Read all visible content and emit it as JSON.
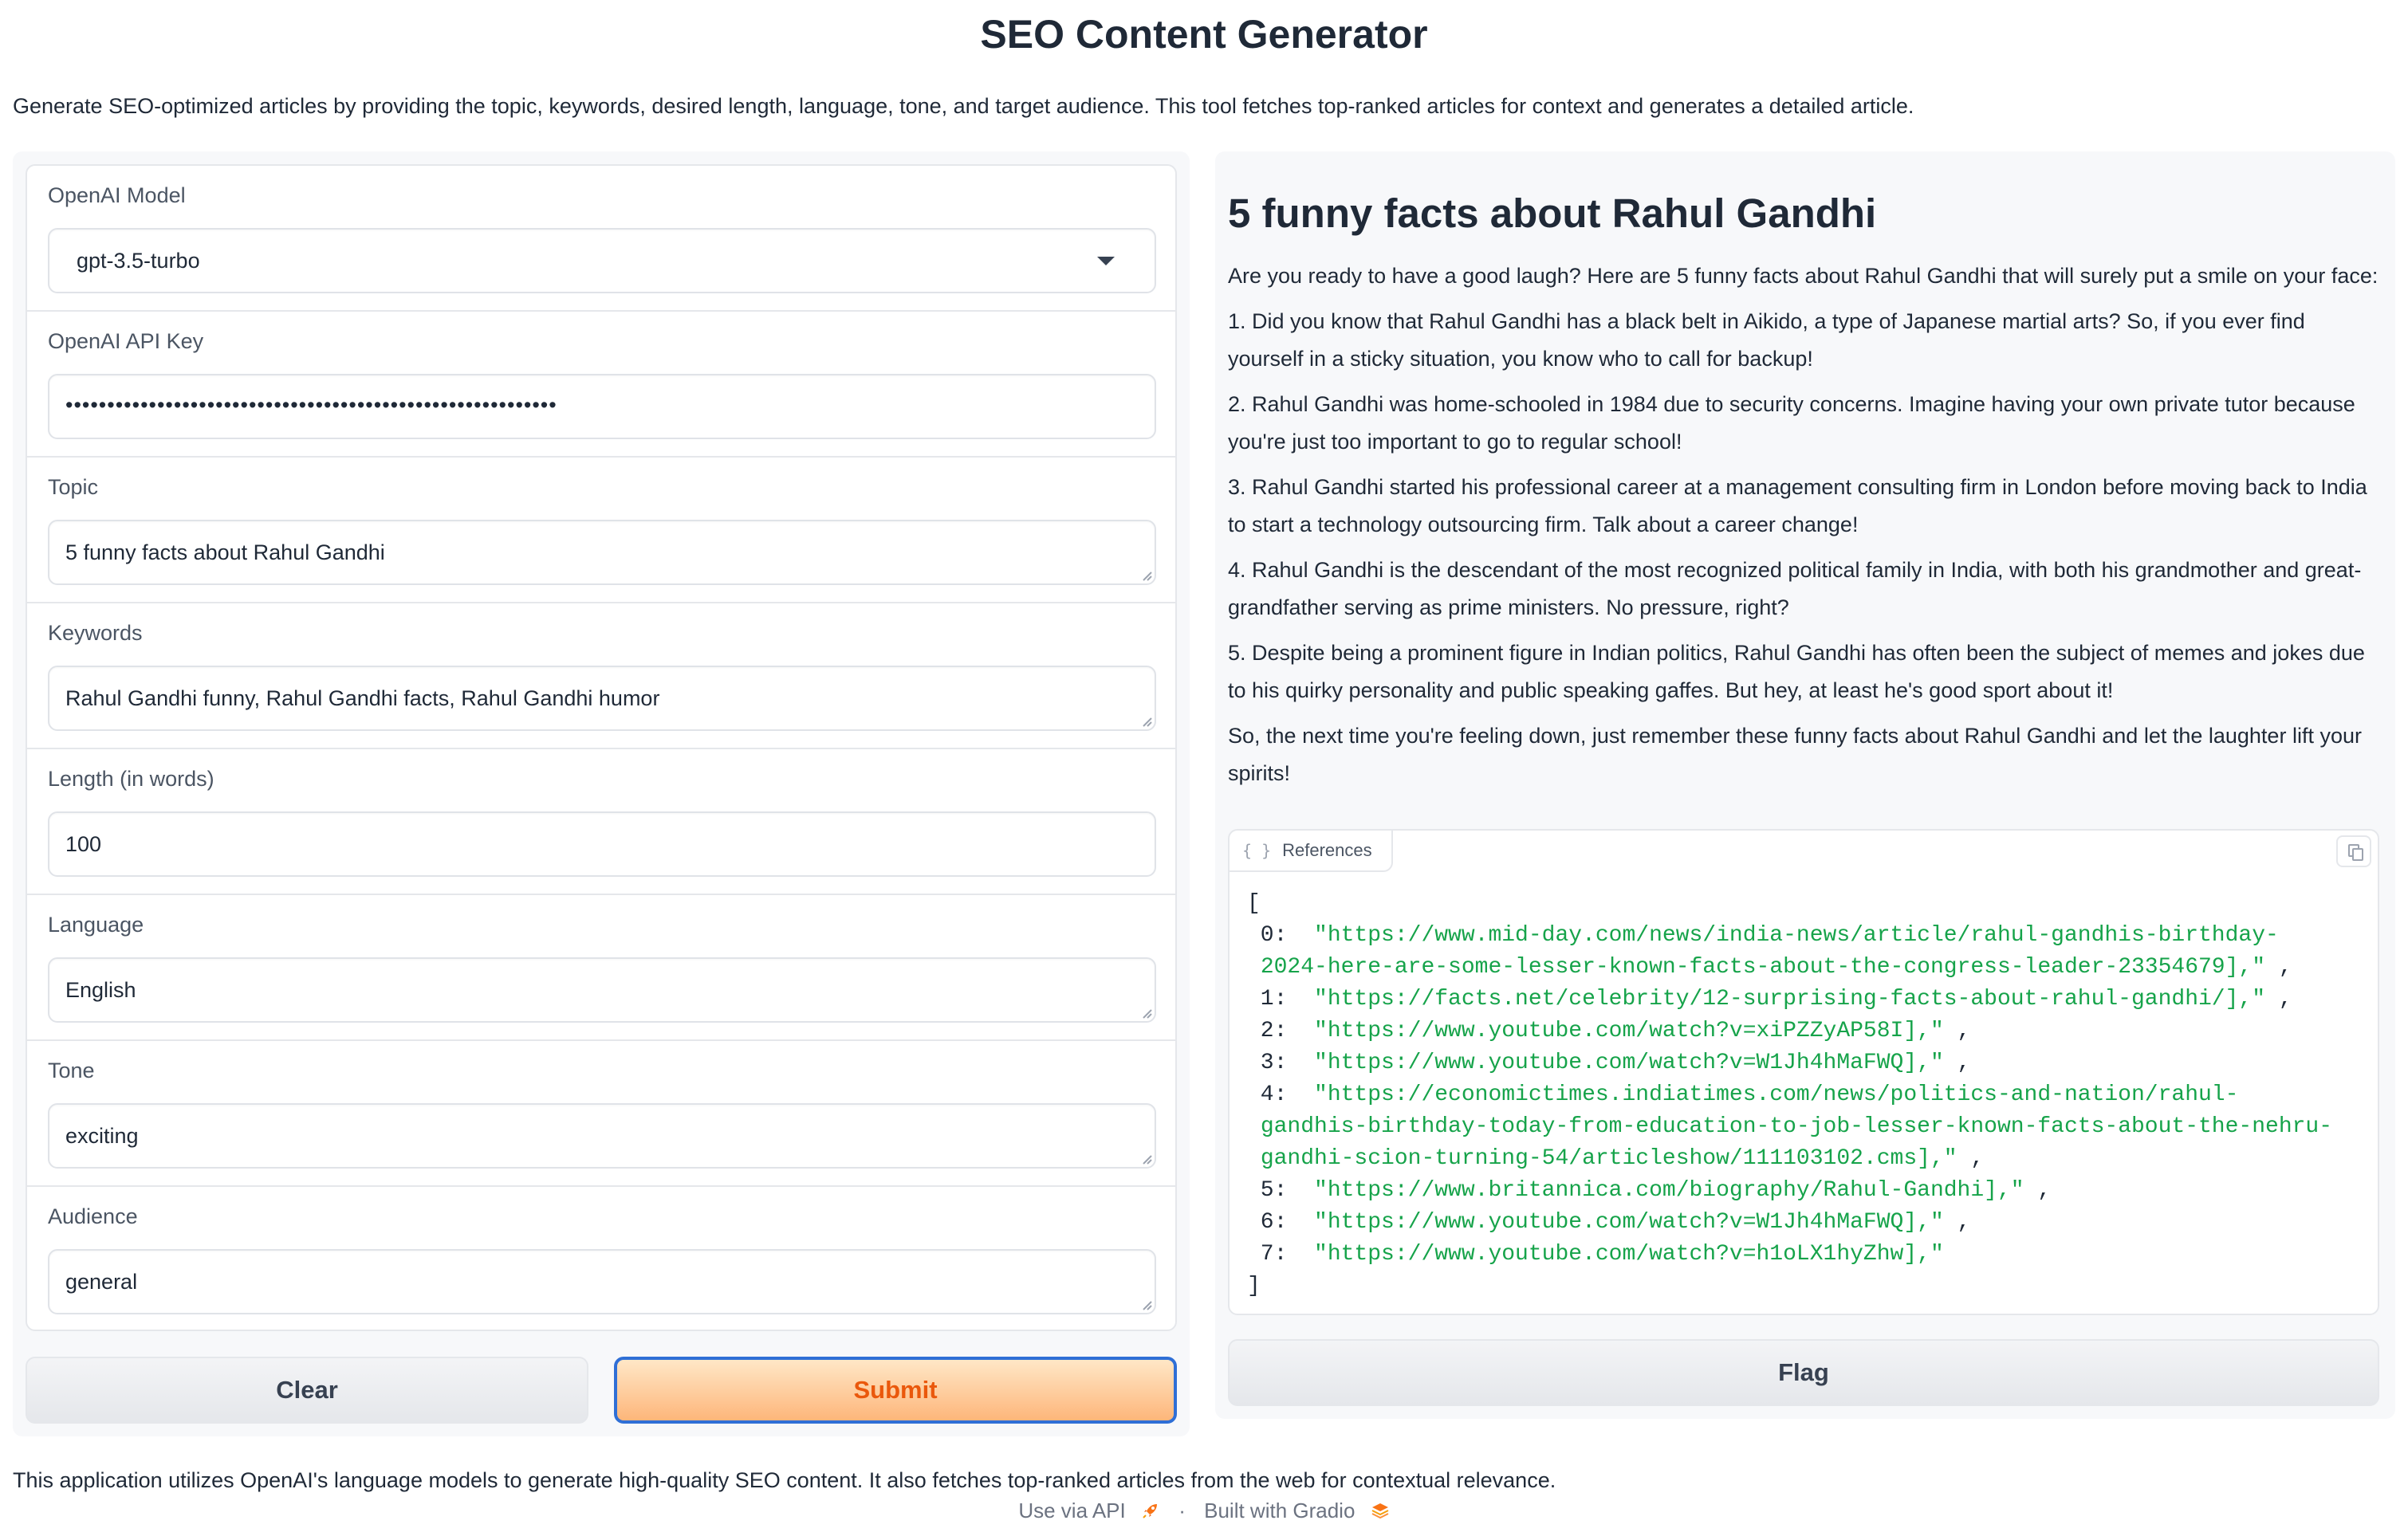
{
  "page": {
    "title": "SEO Content Generator",
    "description": "Generate SEO-optimized articles by providing the topic, keywords, desired length, language, tone, and target audience. This tool fetches top-ranked articles for context and generates a detailed article."
  },
  "form": {
    "model": {
      "label": "OpenAI Model",
      "value": "gpt-3.5-turbo"
    },
    "api_key": {
      "label": "OpenAI API Key",
      "value": "•••••••••••••••••••••••••••••••••••••••••••••••••••••••••••"
    },
    "topic": {
      "label": "Topic",
      "value": "5 funny facts about Rahul Gandhi"
    },
    "keywords": {
      "label": "Keywords",
      "value": "Rahul Gandhi funny, Rahul Gandhi facts, Rahul Gandhi humor"
    },
    "length": {
      "label": "Length (in words)",
      "value": "100"
    },
    "language": {
      "label": "Language",
      "value": "English"
    },
    "tone": {
      "label": "Tone",
      "value": "exciting"
    },
    "audience": {
      "label": "Audience",
      "value": "general"
    },
    "clear_label": "Clear",
    "submit_label": "Submit"
  },
  "article": {
    "heading": "5 funny facts about Rahul Gandhi",
    "paragraphs": [
      "Are you ready to have a good laugh? Here are 5 funny facts about Rahul Gandhi that will surely put a smile on your face:",
      "1. Did you know that Rahul Gandhi has a black belt in Aikido, a type of Japanese martial arts? So, if you ever find yourself in a sticky situation, you know who to call for backup!",
      "2. Rahul Gandhi was home-schooled in 1984 due to security concerns. Imagine having your own private tutor because you're just too important to go to regular school!",
      "3. Rahul Gandhi started his professional career at a management consulting firm in London before moving back to India to start a technology outsourcing firm. Talk about a career change!",
      "4. Rahul Gandhi is the descendant of the most recognized political family in India, with both his grandmother and great-grandfather serving as prime ministers. No pressure, right?",
      "5. Despite being a prominent figure in Indian politics, Rahul Gandhi has often been the subject of memes and jokes due to his quirky personality and public speaking gaffes. But hey, at least he's good sport about it!",
      "So, the next time you're feeling down, just remember these funny facts about Rahul Gandhi and let the laughter lift your spirits!"
    ]
  },
  "references": {
    "label": "References",
    "lines": [
      [
        "0",
        "\"https://www.mid-day.com/news/india-news/article/rahul-gandhis-birthday-",
        ""
      ],
      [
        "",
        "2024-here-are-some-lesser-known-facts-about-the-congress-leader-23354679],\"",
        ","
      ],
      [
        "1",
        "\"https://facts.net/celebrity/12-surprising-facts-about-rahul-gandhi/],\"",
        ","
      ],
      [
        "2",
        "\"https://www.youtube.com/watch?v=xiPZZyAP58I],\"",
        ","
      ],
      [
        "3",
        "\"https://www.youtube.com/watch?v=W1Jh4hMaFWQ],\"",
        ","
      ],
      [
        "4",
        "\"https://economictimes.indiatimes.com/news/politics-and-nation/rahul-",
        ""
      ],
      [
        "",
        "gandhis-birthday-today-from-education-to-job-lesser-known-facts-about-the-nehru-",
        ""
      ],
      [
        "",
        "gandhi-scion-turning-54/articleshow/111103102.cms],\"",
        ","
      ],
      [
        "5",
        "\"https://www.britannica.com/biography/Rahul-Gandhi],\"",
        ","
      ],
      [
        "6",
        "\"https://www.youtube.com/watch?v=W1Jh4hMaFWQ],\"",
        ","
      ],
      [
        "7",
        "\"https://www.youtube.com/watch?v=h1oLX1hyZhw],\"",
        ""
      ]
    ]
  },
  "flag_label": "Flag",
  "footer": {
    "note": "This application utilizes OpenAI's language models to generate high-quality SEO content. It also fetches top-ranked articles from the web for contextual relevance.",
    "api_link": "Use via API",
    "separator": "·",
    "gradio_link": "Built with Gradio"
  }
}
